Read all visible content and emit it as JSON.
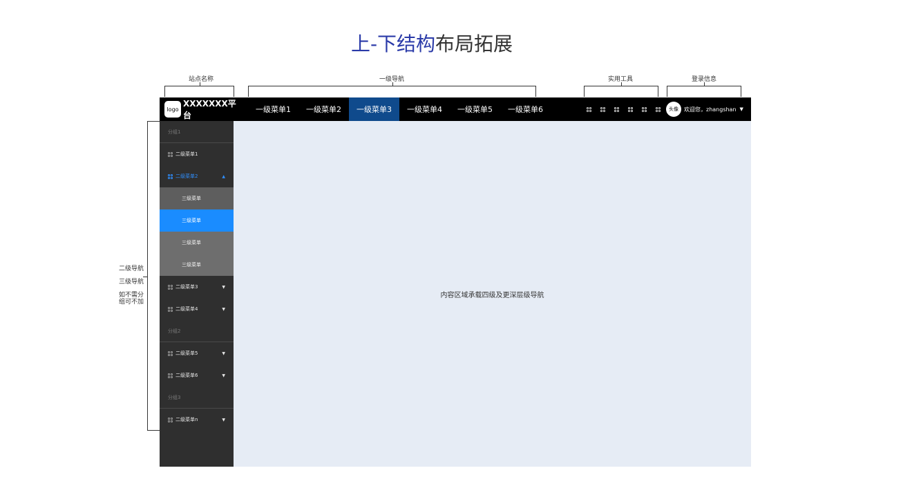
{
  "title": {
    "highlight": "上-下结构",
    "rest": "布局拓展"
  },
  "annotations": {
    "site_name": "站点名称",
    "primary_nav": "一级导航",
    "tools": "实用工具",
    "login_info": "登录信息",
    "side_lines": [
      "二级导航",
      "三级导航",
      "如不需分",
      "组可不加"
    ]
  },
  "header": {
    "logo_text": "logo",
    "site_name": "XXXXXXX平台",
    "nav": [
      "一级菜单1",
      "一级菜单2",
      "一级菜单3",
      "一级菜单4",
      "一级菜单5",
      "一级菜单6"
    ],
    "active_nav_index": 2,
    "tool_icons": [
      "grid-icon",
      "grid-icon",
      "grid-icon",
      "grid-icon",
      "grid-icon",
      "grid-icon"
    ],
    "avatar_text": "头像",
    "welcome_text": "欢迎您，zhangshan"
  },
  "sidebar": {
    "group1": "分组1",
    "menu1": "二级菜单1",
    "menu2": "二级菜单2",
    "submenus": [
      "三级菜单",
      "三级菜单",
      "三级菜单",
      "三级菜单"
    ],
    "menu3": "二级菜单3",
    "menu4": "二级菜单4",
    "group2": "分组2",
    "menu5": "二级菜单5",
    "menu6": "二级菜单6",
    "group3": "分组3",
    "menun": "二级菜单n"
  },
  "content": {
    "text": "内容区域承载四级及更深层级导航"
  },
  "colors": {
    "title_accent": "#2a3aa8",
    "active_nav": "#0f4a8c",
    "active_sub": "#1a8cff",
    "open_menu": "#2f8fff",
    "content_bg": "#e6ecf5"
  }
}
